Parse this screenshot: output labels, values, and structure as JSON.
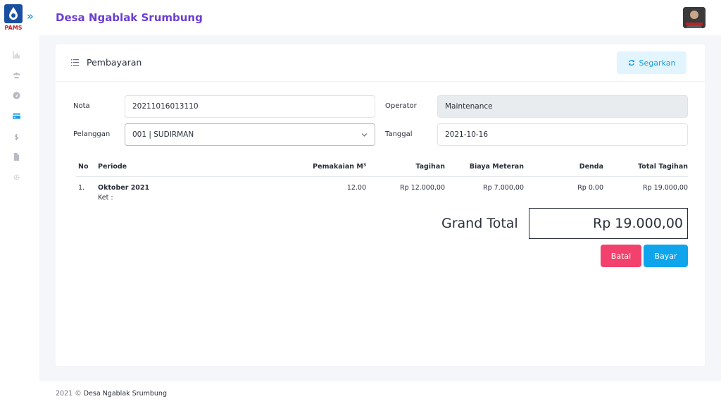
{
  "app": {
    "title": "Desa Ngablak Srumbung",
    "logo_text": "PAMS",
    "accent_color": "#6b3fd1",
    "primary_color": "#0ea5ec",
    "danger_color": "#f1416c"
  },
  "sidebar": {
    "items": [
      {
        "icon": "chart-icon",
        "active": false
      },
      {
        "icon": "users-icon",
        "active": false
      },
      {
        "icon": "dashboard-gauge-icon",
        "active": false
      },
      {
        "icon": "credit-card-icon",
        "active": true
      },
      {
        "icon": "dollar-icon",
        "active": false
      },
      {
        "icon": "document-icon",
        "active": false
      },
      {
        "icon": "gear-icon",
        "active": false
      }
    ]
  },
  "card": {
    "title": "Pembayaran",
    "refresh_label": "Segarkan"
  },
  "form": {
    "nota_label": "Nota",
    "nota_value": "20211016013110",
    "pelanggan_label": "Pelanggan",
    "pelanggan_value": "001 | SUDIRMAN",
    "operator_label": "Operator",
    "operator_value": "Maintenance",
    "tanggal_label": "Tanggal",
    "tanggal_value": "2021-10-16"
  },
  "table": {
    "headers": {
      "no": "No",
      "periode": "Periode",
      "pemakaian": "Pemakaian M",
      "pemakaian_sup": "3",
      "tagihan": "Tagihan",
      "biaya": "Biaya Meteran",
      "denda": "Denda",
      "total": "Total Tagihan"
    },
    "rows": [
      {
        "no": "1.",
        "periode": "Oktober 2021",
        "ket": "Ket :",
        "pemakaian": "12.00",
        "tagihan": "Rp 12.000,00",
        "biaya": "Rp 7.000,00",
        "denda": "Rp 0,00",
        "total": "Rp 19.000,00"
      }
    ]
  },
  "summary": {
    "grand_total_label": "Grand Total",
    "grand_total_value": "Rp 19.000,00",
    "batal_label": "Batal",
    "bayar_label": "Bayar"
  },
  "footer": {
    "year": "2021 ©",
    "brand": "Desa Ngablak Srumbung"
  }
}
